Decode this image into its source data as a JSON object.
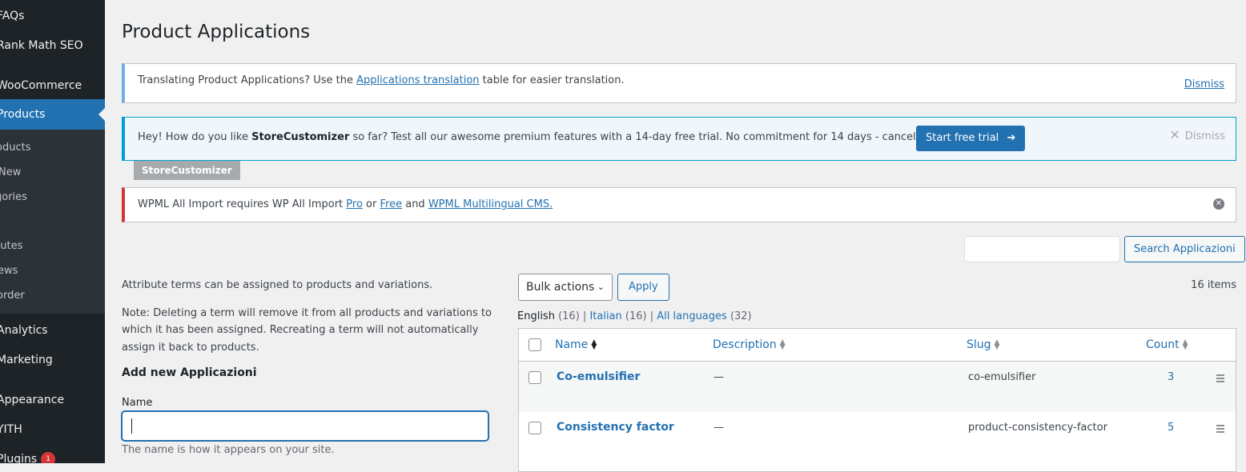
{
  "sidebar": {
    "items": [
      {
        "label": "FAQs"
      },
      {
        "label": "Rank Math SEO"
      },
      {
        "label": "WooCommerce"
      },
      {
        "label": "Products"
      },
      {
        "label": "Analytics"
      },
      {
        "label": "Marketing"
      },
      {
        "label": "Appearance"
      },
      {
        "label": "YITH"
      },
      {
        "label": "Plugins",
        "badge": "1"
      }
    ],
    "submenu": [
      "roducts",
      "New",
      "gories",
      "butes",
      "ews",
      "order"
    ]
  },
  "page": {
    "title": "Product Applications"
  },
  "notices": {
    "translation": {
      "text_before": "Translating Product Applications? Use the ",
      "link": "Applications translation",
      "text_after": " table for easier translation.",
      "dismiss": "Dismiss"
    },
    "storecustomizer": {
      "text_before": "Hey! How do you like ",
      "brand": "StoreCustomizer",
      "text_after": " so far? Test all our awesome premium features with a 14-day free trial. No commitment for 14 days - cancel anytime!",
      "button": "Start free trial",
      "arrow": "➔",
      "dismiss": "Dismiss",
      "tag": "StoreCustomizer"
    },
    "wpml": {
      "text_before": "WPML All Import requires WP All Import ",
      "link_pro": "Pro",
      "or": " or ",
      "link_free": "Free",
      "and": " and ",
      "link_wpml": "WPML Multilingual CMS."
    }
  },
  "search": {
    "button": "Search Applicazioni",
    "value": ""
  },
  "form": {
    "intro": "Attribute terms can be assigned to products and variations.",
    "note": "Note: Deleting a term will remove it from all products and variations to which it has been assigned. Recreating a term will not automatically assign it back to products.",
    "title": "Add new Applicazioni",
    "name_label": "Name",
    "name_value": "",
    "name_help": "The name is how it appears on your site."
  },
  "toolbar": {
    "bulk_actions": "Bulk actions",
    "apply": "Apply",
    "items_count": "16 items"
  },
  "languages": [
    {
      "label": "English",
      "count": "(16)",
      "current": true
    },
    {
      "label": "Italian",
      "count": "(16)",
      "current": false
    },
    {
      "label": "All languages",
      "count": "(32)",
      "current": false
    }
  ],
  "table": {
    "columns": [
      "Name",
      "Description",
      "Slug",
      "Count"
    ],
    "rows": [
      {
        "name": "Co-emulsifier",
        "description": "—",
        "slug": "co-emulsifier",
        "count": "3"
      },
      {
        "name": "Consistency factor",
        "description": "—",
        "slug": "product-consistency-factor",
        "count": "5"
      }
    ]
  },
  "colors": {
    "accent": "#2271b1",
    "sidebar_bg": "#1d2327",
    "error": "#d63638"
  }
}
